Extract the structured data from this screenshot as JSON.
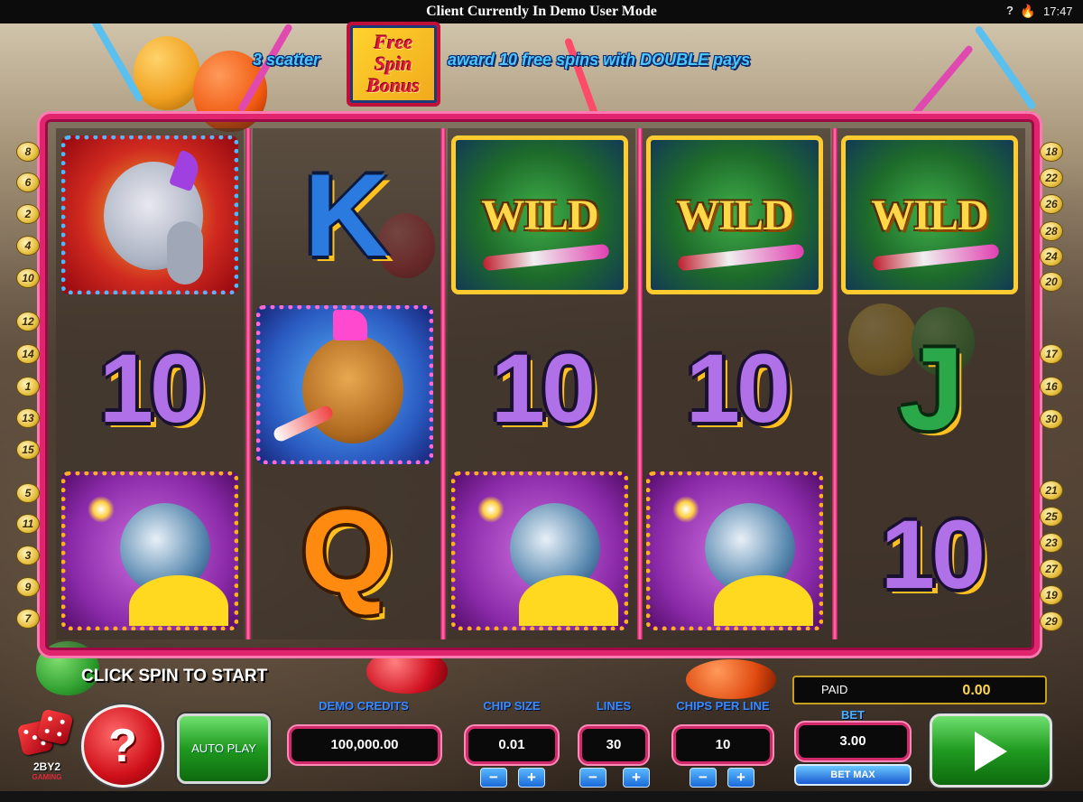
{
  "window": {
    "title": "Client Currently In Demo User Mode",
    "help_glyph": "?",
    "fire_glyph": "🔥",
    "clock": "17:47"
  },
  "promo": {
    "left_text": "3 scatter",
    "badge_lines": [
      "Free",
      "Spin",
      "Bonus"
    ],
    "right_text": "award 10 free spins with DOUBLE pays"
  },
  "reels": [
    {
      "symbols": [
        "elephant",
        "10",
        "parrot"
      ]
    },
    {
      "symbols": [
        "K",
        "bear",
        "Q"
      ]
    },
    {
      "symbols": [
        "WILD",
        "10",
        "parrot"
      ]
    },
    {
      "symbols": [
        "WILD",
        "10",
        "parrot"
      ]
    },
    {
      "symbols": [
        "WILD",
        "J",
        "10"
      ]
    }
  ],
  "paylines": {
    "left": [
      "8",
      "6",
      "2",
      "4",
      "10",
      "12",
      "14",
      "1",
      "13",
      "15",
      "5",
      "11",
      "3",
      "9",
      "7"
    ],
    "right": [
      "18",
      "22",
      "26",
      "28",
      "24",
      "20",
      "17",
      "16",
      "30",
      "21",
      "25",
      "23",
      "27",
      "19",
      "29"
    ]
  },
  "status": {
    "message": "CLICK SPIN TO START"
  },
  "logo": {
    "name": "2BY2",
    "sub": "GAMING"
  },
  "controls": {
    "help_label": "?",
    "autoplay_label": "AUTO PLAY",
    "credits": {
      "label": "DEMO CREDITS",
      "value": "100,000.00"
    },
    "chip_size": {
      "label": "CHIP SIZE",
      "value": "0.01"
    },
    "lines": {
      "label": "LINES",
      "value": "30"
    },
    "chips_per_line": {
      "label": "CHIPS PER LINE",
      "value": "10"
    },
    "paid": {
      "label": "PAID",
      "value": "0.00"
    },
    "bet": {
      "label": "BET",
      "value": "3.00"
    },
    "bet_max_label": "BET MAX",
    "minus": "−",
    "plus": "+"
  },
  "colors": {
    "frame": "#e0246e",
    "credit_label": "#3a8aff",
    "wild_gold": "#ffd84a",
    "promo_blue": "#4cc6ff"
  }
}
